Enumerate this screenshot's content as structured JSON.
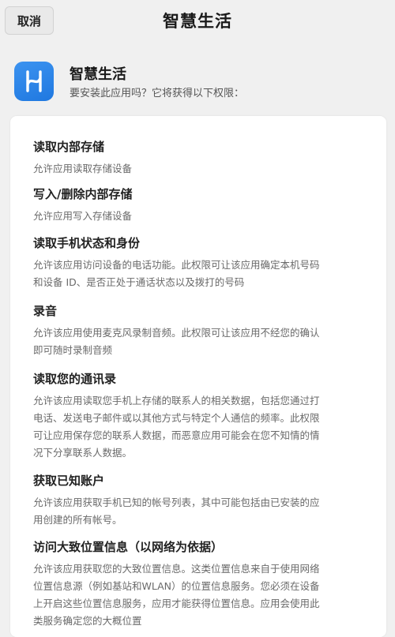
{
  "header": {
    "cancel_label": "取消",
    "title": "智慧生活"
  },
  "app": {
    "icon": "smart-life-logo-icon",
    "name": "智慧生活",
    "question": "要安装此应用吗？它将获得以下权限："
  },
  "colors": {
    "background": "#f0f0f0",
    "card": "#ffffff",
    "app_icon_blue": "#2a86ea"
  },
  "permissions": [
    {
      "title": "读取内部存储",
      "desc_lines": [
        "允许应用读取存储设备"
      ]
    },
    {
      "title": "写入/删除内部存储",
      "desc_lines": [
        "允许应用写入存储设备"
      ]
    },
    {
      "title": "读取手机状态和身份",
      "desc_lines": [
        "允许该应用访问设备的电话功能。此权限可让该应用确定本机号码",
        "和设备 ID、是否正处于通话状态以及拨打的号码"
      ]
    },
    {
      "title": "录音",
      "desc_lines": [
        "允许该应用使用麦克风录制音频。此权限可让该应用不经您的确认",
        "即可随时录制音频"
      ]
    },
    {
      "title": "读取您的通讯录",
      "desc_lines": [
        "允许该应用读取您手机上存储的联系人的相关数据，包括您通过打",
        "电话、发送电子邮件或以其他方式与特定个人通信的频率。此权限",
        "可让应用保存您的联系人数据，而恶意应用可能会在您不知情的情",
        "况下分享联系人数据。"
      ]
    },
    {
      "title": "获取已知账户",
      "desc_lines": [
        "允许该应用获取手机已知的帐号列表，其中可能包括由已安装的应",
        "用创建的所有帐号。"
      ]
    },
    {
      "title": "访问大致位置信息（以网络为依据）",
      "desc_lines": [
        "允许该应用获取您的大致位置信息。这类位置信息来自于使用网络",
        "位置信息源（例如基站和WLAN）的位置信息服务。您必须在设备",
        "上开启这些位置信息服务，应用才能获得位置信息。应用会使用此",
        "类服务确定您的大概位置"
      ]
    }
  ]
}
